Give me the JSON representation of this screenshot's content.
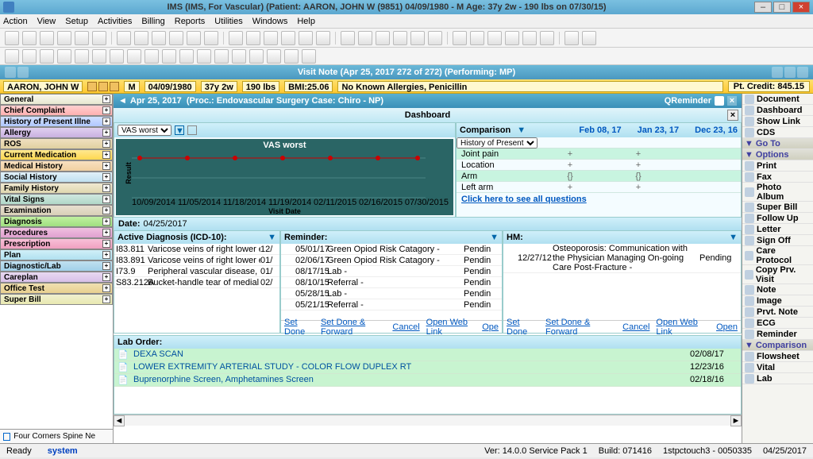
{
  "title": "IMS (IMS, For Vascular)    (Patient: AARON, JOHN W (9851) 04/09/1980 - M Age: 37y 2w - 190 lbs on 07/30/15)",
  "menu": [
    "Action",
    "View",
    "Setup",
    "Activities",
    "Billing",
    "Reports",
    "Utilities",
    "Windows",
    "Help"
  ],
  "visit_header": "Visit Note (Apr 25, 2017   272 of 272) (Performing: MP)",
  "patient": {
    "name": "AARON, JOHN W",
    "sex": "M",
    "dob": "04/09/1980",
    "age": "37y 2w",
    "weight": "190 lbs",
    "bmi_label": "BMI:25.06",
    "allergies": "No Known Allergies, Penicillin",
    "credit_label": "Pt. Credit: 845.15"
  },
  "leftnav": [
    {
      "label": "General",
      "cls": "nav-general"
    },
    {
      "label": "Chief Complaint",
      "cls": "nav-chief"
    },
    {
      "label": "History of Present Illne",
      "cls": "nav-hpi"
    },
    {
      "label": "Allergy",
      "cls": "nav-allergy"
    },
    {
      "label": "ROS",
      "cls": "nav-ros"
    },
    {
      "label": "Current Medication",
      "cls": "nav-curmed"
    },
    {
      "label": "Medical History",
      "cls": "nav-medhx"
    },
    {
      "label": "Social History",
      "cls": "nav-sochx"
    },
    {
      "label": "Family History",
      "cls": "nav-famhx"
    },
    {
      "label": "Vital Signs",
      "cls": "nav-vitals"
    },
    {
      "label": "Examination",
      "cls": "nav-exam"
    },
    {
      "label": "Diagnosis",
      "cls": "nav-diag"
    },
    {
      "label": "Procedures",
      "cls": "nav-proc"
    },
    {
      "label": "Prescription",
      "cls": "nav-rx"
    },
    {
      "label": "Plan",
      "cls": "nav-plan"
    },
    {
      "label": "Diagnostic/Lab",
      "cls": "nav-dxlab"
    },
    {
      "label": "Careplan",
      "cls": "nav-careplan"
    },
    {
      "label": "Office Test",
      "cls": "nav-office"
    },
    {
      "label": "Super Bill",
      "cls": "nav-super"
    }
  ],
  "left_footer": "Four Corners Spine Ne",
  "procbar": {
    "date": "Apr 25, 2017",
    "detail": "(Proc.: Endovascular Surgery  Case: Chiro - NP)",
    "reminder": "QReminder"
  },
  "dashboard": {
    "title": "Dashboard",
    "date_label": "Date:",
    "date_value": "04/25/2017"
  },
  "chart_data": {
    "type": "line",
    "selector": "VAS worst",
    "title": "VAS worst",
    "xlabel": "Visit Date",
    "ylabel": "Result",
    "x": [
      "10/09/2014",
      "11/05/2014",
      "11/18/2014",
      "11/19/2014",
      "02/11/2015",
      "02/16/2015",
      "07/30/2015"
    ],
    "y": [
      8,
      8,
      8,
      8,
      8,
      8,
      8
    ],
    "yticks": [
      4,
      6,
      8
    ],
    "ylim": [
      3,
      9
    ]
  },
  "comparison": {
    "title": "Comparison",
    "dropdown": "History of Present",
    "dates": [
      "Feb 08, 17",
      "Jan 23, 17",
      "Dec 23, 16"
    ],
    "rows": [
      {
        "label": "Joint pain",
        "vals": [
          "+",
          "+",
          ""
        ]
      },
      {
        "label": "Location",
        "vals": [
          "+",
          "+",
          ""
        ]
      },
      {
        "label": "Arm",
        "vals": [
          "{<C_image_1>}",
          "{<C_image_2>}",
          ""
        ]
      },
      {
        "label": "Left arm",
        "vals": [
          "+",
          "+",
          ""
        ]
      }
    ],
    "see_all": "Click here to see all questions"
  },
  "active_diag": {
    "title": "Active Diagnosis (ICD-10):",
    "rows": [
      {
        "code": "I83.811",
        "desc": "Varicose veins of right lower extremities w",
        "date": "12/"
      },
      {
        "code": "I83.891",
        "desc": "Varicose veins of right lower extremities w",
        "date": "01/"
      },
      {
        "code": "I73.9",
        "desc": "Peripheral vascular disease, unspecified",
        "date": "01/"
      },
      {
        "code": "S83.212A",
        "desc": "Bucket-handle tear of medial meniscus, c",
        "date": "02/"
      }
    ]
  },
  "reminder": {
    "title": "Reminder:",
    "rows": [
      {
        "date": "05/01/17",
        "desc": "Green Opiod Risk Catagory  -",
        "status": "Pendin"
      },
      {
        "date": "02/06/17",
        "desc": "Green Opiod Risk Catagory  -",
        "status": "Pendin"
      },
      {
        "date": "08/17/15",
        "desc": "Lab  -",
        "status": "Pendin"
      },
      {
        "date": "08/10/15",
        "desc": "Referral  -",
        "status": "Pendin"
      },
      {
        "date": "05/28/15",
        "desc": "Lab  -",
        "status": "Pendin"
      },
      {
        "date": "05/21/15",
        "desc": "Referral  -",
        "status": "Pendin"
      }
    ],
    "actions": [
      "Set Done",
      "Set Done & Forward",
      "Cancel",
      "Open Web Link",
      "Ope"
    ]
  },
  "hm": {
    "title": "HM:",
    "rows": [
      {
        "date": "12/27/12",
        "desc": "Osteoporosis: Communication with the Physician Managing On-going Care Post-Fracture  -",
        "status": "Pending"
      }
    ],
    "actions": [
      "Set Done",
      "Set Done & Forward",
      "Cancel",
      "Open Web Link",
      "Open"
    ]
  },
  "laborder": {
    "title": "Lab Order:",
    "rows": [
      {
        "name": "DEXA SCAN",
        "date": "02/08/17"
      },
      {
        "name": "LOWER EXTREMITY ARTERIAL STUDY - COLOR FLOW DUPLEX RT",
        "date": "12/23/16"
      },
      {
        "name": "Buprenorphine Screen, Amphetamines Screen",
        "date": "02/18/16"
      }
    ]
  },
  "rightnav": [
    {
      "label": "Document",
      "type": "item"
    },
    {
      "label": "Dashboard",
      "type": "item"
    },
    {
      "label": "Show Link",
      "type": "item"
    },
    {
      "label": "CDS",
      "type": "item"
    },
    {
      "label": "Go To",
      "type": "hdr"
    },
    {
      "label": "Options",
      "type": "hdr"
    },
    {
      "label": "Print",
      "type": "item"
    },
    {
      "label": "Fax",
      "type": "item"
    },
    {
      "label": "Photo Album",
      "type": "item",
      "tall": true
    },
    {
      "label": "Super Bill",
      "type": "item"
    },
    {
      "label": "Follow Up",
      "type": "item"
    },
    {
      "label": "Letter",
      "type": "item"
    },
    {
      "label": "Sign Off",
      "type": "item"
    },
    {
      "label": "Care Protocol",
      "type": "item",
      "tall": true
    },
    {
      "label": "Copy Prv. Visit",
      "type": "item",
      "tall": true
    },
    {
      "label": "Note",
      "type": "item"
    },
    {
      "label": "Image",
      "type": "item"
    },
    {
      "label": "Prvt. Note",
      "type": "item"
    },
    {
      "label": "ECG",
      "type": "item"
    },
    {
      "label": "Reminder",
      "type": "item"
    },
    {
      "label": "Comparison",
      "type": "hdr"
    },
    {
      "label": "Flowsheet",
      "type": "item"
    },
    {
      "label": "Vital",
      "type": "item"
    },
    {
      "label": "Lab",
      "type": "item"
    }
  ],
  "status": {
    "ready": "Ready",
    "system": "system",
    "ver": "Ver: 14.0.0 Service Pack 1",
    "build": "Build: 071416",
    "session": "1stpctouch3 - 0050335",
    "date": "04/25/2017"
  }
}
